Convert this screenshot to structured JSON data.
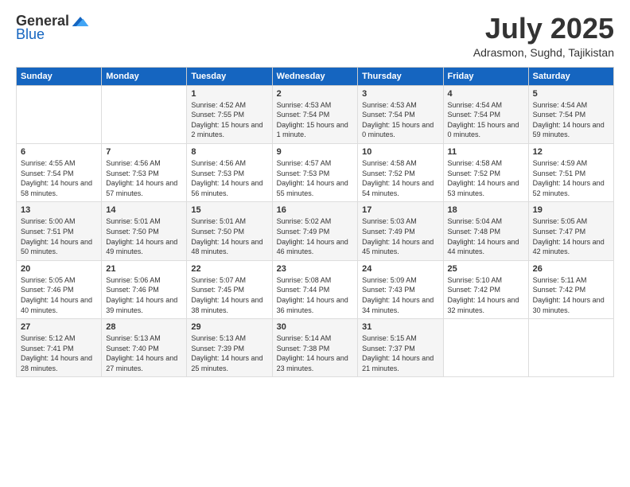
{
  "header": {
    "logo_general": "General",
    "logo_blue": "Blue",
    "month_title": "July 2025",
    "location": "Adrasmon, Sughd, Tajikistan"
  },
  "weekdays": [
    "Sunday",
    "Monday",
    "Tuesday",
    "Wednesday",
    "Thursday",
    "Friday",
    "Saturday"
  ],
  "weeks": [
    [
      {
        "day": "",
        "sunrise": "",
        "sunset": "",
        "daylight": ""
      },
      {
        "day": "",
        "sunrise": "",
        "sunset": "",
        "daylight": ""
      },
      {
        "day": "1",
        "sunrise": "Sunrise: 4:52 AM",
        "sunset": "Sunset: 7:55 PM",
        "daylight": "Daylight: 15 hours and 2 minutes."
      },
      {
        "day": "2",
        "sunrise": "Sunrise: 4:53 AM",
        "sunset": "Sunset: 7:54 PM",
        "daylight": "Daylight: 15 hours and 1 minute."
      },
      {
        "day": "3",
        "sunrise": "Sunrise: 4:53 AM",
        "sunset": "Sunset: 7:54 PM",
        "daylight": "Daylight: 15 hours and 0 minutes."
      },
      {
        "day": "4",
        "sunrise": "Sunrise: 4:54 AM",
        "sunset": "Sunset: 7:54 PM",
        "daylight": "Daylight: 15 hours and 0 minutes."
      },
      {
        "day": "5",
        "sunrise": "Sunrise: 4:54 AM",
        "sunset": "Sunset: 7:54 PM",
        "daylight": "Daylight: 14 hours and 59 minutes."
      }
    ],
    [
      {
        "day": "6",
        "sunrise": "Sunrise: 4:55 AM",
        "sunset": "Sunset: 7:54 PM",
        "daylight": "Daylight: 14 hours and 58 minutes."
      },
      {
        "day": "7",
        "sunrise": "Sunrise: 4:56 AM",
        "sunset": "Sunset: 7:53 PM",
        "daylight": "Daylight: 14 hours and 57 minutes."
      },
      {
        "day": "8",
        "sunrise": "Sunrise: 4:56 AM",
        "sunset": "Sunset: 7:53 PM",
        "daylight": "Daylight: 14 hours and 56 minutes."
      },
      {
        "day": "9",
        "sunrise": "Sunrise: 4:57 AM",
        "sunset": "Sunset: 7:53 PM",
        "daylight": "Daylight: 14 hours and 55 minutes."
      },
      {
        "day": "10",
        "sunrise": "Sunrise: 4:58 AM",
        "sunset": "Sunset: 7:52 PM",
        "daylight": "Daylight: 14 hours and 54 minutes."
      },
      {
        "day": "11",
        "sunrise": "Sunrise: 4:58 AM",
        "sunset": "Sunset: 7:52 PM",
        "daylight": "Daylight: 14 hours and 53 minutes."
      },
      {
        "day": "12",
        "sunrise": "Sunrise: 4:59 AM",
        "sunset": "Sunset: 7:51 PM",
        "daylight": "Daylight: 14 hours and 52 minutes."
      }
    ],
    [
      {
        "day": "13",
        "sunrise": "Sunrise: 5:00 AM",
        "sunset": "Sunset: 7:51 PM",
        "daylight": "Daylight: 14 hours and 50 minutes."
      },
      {
        "day": "14",
        "sunrise": "Sunrise: 5:01 AM",
        "sunset": "Sunset: 7:50 PM",
        "daylight": "Daylight: 14 hours and 49 minutes."
      },
      {
        "day": "15",
        "sunrise": "Sunrise: 5:01 AM",
        "sunset": "Sunset: 7:50 PM",
        "daylight": "Daylight: 14 hours and 48 minutes."
      },
      {
        "day": "16",
        "sunrise": "Sunrise: 5:02 AM",
        "sunset": "Sunset: 7:49 PM",
        "daylight": "Daylight: 14 hours and 46 minutes."
      },
      {
        "day": "17",
        "sunrise": "Sunrise: 5:03 AM",
        "sunset": "Sunset: 7:49 PM",
        "daylight": "Daylight: 14 hours and 45 minutes."
      },
      {
        "day": "18",
        "sunrise": "Sunrise: 5:04 AM",
        "sunset": "Sunset: 7:48 PM",
        "daylight": "Daylight: 14 hours and 44 minutes."
      },
      {
        "day": "19",
        "sunrise": "Sunrise: 5:05 AM",
        "sunset": "Sunset: 7:47 PM",
        "daylight": "Daylight: 14 hours and 42 minutes."
      }
    ],
    [
      {
        "day": "20",
        "sunrise": "Sunrise: 5:05 AM",
        "sunset": "Sunset: 7:46 PM",
        "daylight": "Daylight: 14 hours and 40 minutes."
      },
      {
        "day": "21",
        "sunrise": "Sunrise: 5:06 AM",
        "sunset": "Sunset: 7:46 PM",
        "daylight": "Daylight: 14 hours and 39 minutes."
      },
      {
        "day": "22",
        "sunrise": "Sunrise: 5:07 AM",
        "sunset": "Sunset: 7:45 PM",
        "daylight": "Daylight: 14 hours and 38 minutes."
      },
      {
        "day": "23",
        "sunrise": "Sunrise: 5:08 AM",
        "sunset": "Sunset: 7:44 PM",
        "daylight": "Daylight: 14 hours and 36 minutes."
      },
      {
        "day": "24",
        "sunrise": "Sunrise: 5:09 AM",
        "sunset": "Sunset: 7:43 PM",
        "daylight": "Daylight: 14 hours and 34 minutes."
      },
      {
        "day": "25",
        "sunrise": "Sunrise: 5:10 AM",
        "sunset": "Sunset: 7:42 PM",
        "daylight": "Daylight: 14 hours and 32 minutes."
      },
      {
        "day": "26",
        "sunrise": "Sunrise: 5:11 AM",
        "sunset": "Sunset: 7:42 PM",
        "daylight": "Daylight: 14 hours and 30 minutes."
      }
    ],
    [
      {
        "day": "27",
        "sunrise": "Sunrise: 5:12 AM",
        "sunset": "Sunset: 7:41 PM",
        "daylight": "Daylight: 14 hours and 28 minutes."
      },
      {
        "day": "28",
        "sunrise": "Sunrise: 5:13 AM",
        "sunset": "Sunset: 7:40 PM",
        "daylight": "Daylight: 14 hours and 27 minutes."
      },
      {
        "day": "29",
        "sunrise": "Sunrise: 5:13 AM",
        "sunset": "Sunset: 7:39 PM",
        "daylight": "Daylight: 14 hours and 25 minutes."
      },
      {
        "day": "30",
        "sunrise": "Sunrise: 5:14 AM",
        "sunset": "Sunset: 7:38 PM",
        "daylight": "Daylight: 14 hours and 23 minutes."
      },
      {
        "day": "31",
        "sunrise": "Sunrise: 5:15 AM",
        "sunset": "Sunset: 7:37 PM",
        "daylight": "Daylight: 14 hours and 21 minutes."
      },
      {
        "day": "",
        "sunrise": "",
        "sunset": "",
        "daylight": ""
      },
      {
        "day": "",
        "sunrise": "",
        "sunset": "",
        "daylight": ""
      }
    ]
  ]
}
